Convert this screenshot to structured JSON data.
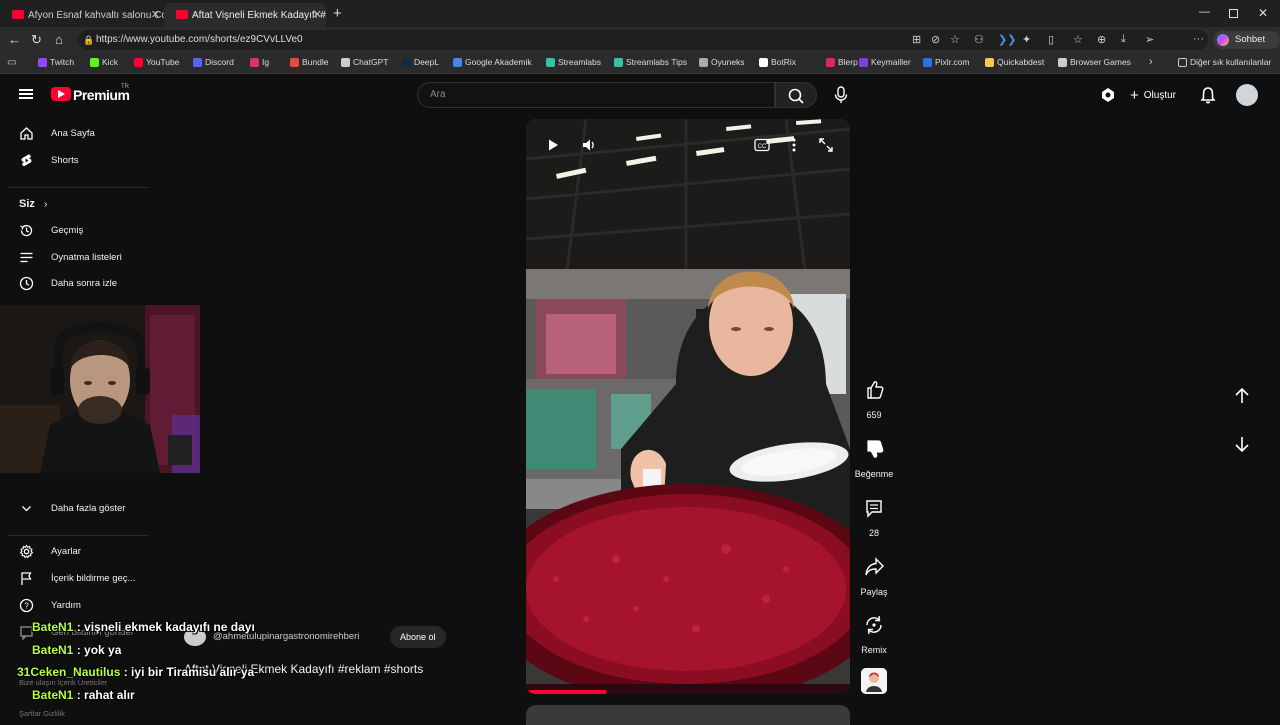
{
  "tabs": [
    {
      "title": "Afyon Esnaf kahvaltı salonu Coğraf"
    },
    {
      "title": "Aftat Vişneli Ekmek Kadayıfı #"
    }
  ],
  "address": {
    "url": "https://www.youtube.com/shorts/ez9CVvLLVe0"
  },
  "copilot_label": "Sohbet et",
  "bookmarks": [
    "Twitch",
    "Kick",
    "YouTube",
    "Discord",
    "Ig",
    "Bundle",
    "ChatGPT",
    "DeepL",
    "Google Akademik",
    "Streamlabs",
    "Streamlabs Tips",
    "Oyuneks",
    "BotRix",
    "Blerp",
    "Keymailler",
    "Pixlr.com",
    "Quickabdest",
    "Browser Games"
  ],
  "bookmarks_other": "Diğer sık kullanılanlar",
  "bookmark_colors": [
    "#9146ff",
    "#53fc18",
    "#ff0033",
    "#5865f2",
    "#e1306c",
    "#e74c3c",
    "#cccccc",
    "#0f2b46",
    "#4285f4",
    "#31c3a2",
    "#31c3a2",
    "#aaaaaa",
    "#ffffff",
    "#e0245e",
    "#7b3fe4",
    "#2f6fed",
    "#f2c94c",
    "#cccccc"
  ],
  "header": {
    "brand": "Premium",
    "brand_country": "TR",
    "search_placeholder": "Ara",
    "create_label": "Oluştur"
  },
  "sidebar": {
    "top": [
      {
        "label": "Ana Sayfa",
        "icon": "home-icon"
      },
      {
        "label": "Shorts",
        "icon": "shorts-icon"
      }
    ],
    "you_heading": "Siz",
    "you": [
      {
        "label": "Geçmiş",
        "icon": "history-icon"
      },
      {
        "label": "Oynatma listeleri",
        "icon": "playlist-icon"
      },
      {
        "label": "Daha sonra izle",
        "icon": "clock-icon"
      }
    ],
    "show_more": "Daha fazla göster",
    "bottom": [
      {
        "label": "Ayarlar",
        "icon": "gear-icon"
      },
      {
        "label": "İçerik bildirme geç...",
        "icon": "flag-icon"
      },
      {
        "label": "Yardım",
        "icon": "help-icon"
      },
      {
        "label": "Geri bildirim gönder",
        "icon": "feedback-icon"
      }
    ],
    "footer": [
      "Bize ulaşın  İçerik Üreticiler",
      "Şartlar  Gizlilik"
    ]
  },
  "actions": {
    "like_count": "659",
    "dislike_label": "Beğenme",
    "comment_count": "28",
    "share_label": "Paylaş",
    "remix_label": "Remix"
  },
  "video": {
    "channel": "@ahmetulupinargastronomirehberi",
    "subscribe_label": "Abone ol",
    "title": "Aftat Vişneli Ekmek Kadayıfı #reklam #shorts"
  },
  "chat": [
    {
      "user": "BateN1",
      "message": " : vişneli ekmek kadayıfı ne dayı"
    },
    {
      "user": "BateN1",
      "message": " : yok ya"
    },
    {
      "user": "31Ceken_Nautilus",
      "message": " : iyi bir Tiramisu alır ya"
    },
    {
      "user": "BateN1",
      "message": " : rahat alır"
    }
  ]
}
